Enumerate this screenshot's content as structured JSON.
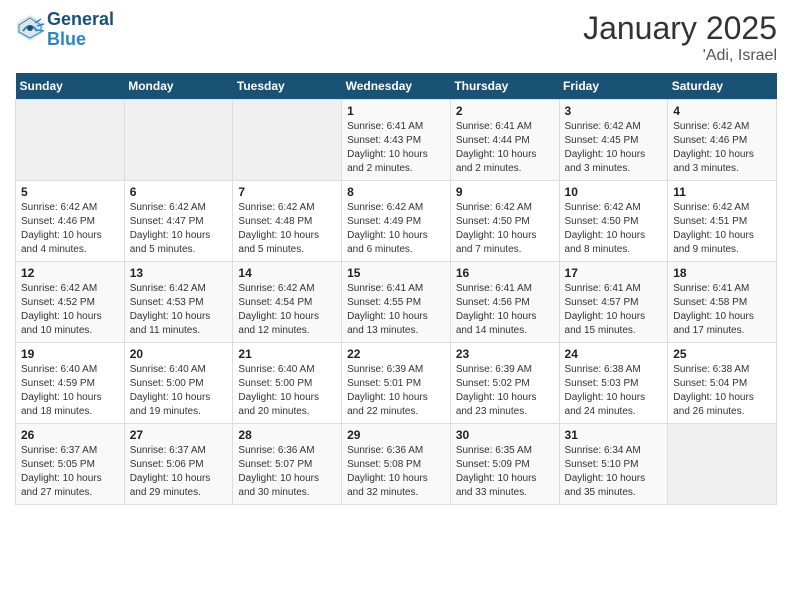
{
  "header": {
    "logo_line1": "General",
    "logo_line2": "Blue",
    "month": "January 2025",
    "location": "'Adi, Israel"
  },
  "weekdays": [
    "Sunday",
    "Monday",
    "Tuesday",
    "Wednesday",
    "Thursday",
    "Friday",
    "Saturday"
  ],
  "weeks": [
    [
      {
        "day": "",
        "sunrise": "",
        "sunset": "",
        "daylight": "",
        "empty": true
      },
      {
        "day": "",
        "sunrise": "",
        "sunset": "",
        "daylight": "",
        "empty": true
      },
      {
        "day": "",
        "sunrise": "",
        "sunset": "",
        "daylight": "",
        "empty": true
      },
      {
        "day": "1",
        "sunrise": "Sunrise: 6:41 AM",
        "sunset": "Sunset: 4:43 PM",
        "daylight": "Daylight: 10 hours and 2 minutes.",
        "empty": false
      },
      {
        "day": "2",
        "sunrise": "Sunrise: 6:41 AM",
        "sunset": "Sunset: 4:44 PM",
        "daylight": "Daylight: 10 hours and 2 minutes.",
        "empty": false
      },
      {
        "day": "3",
        "sunrise": "Sunrise: 6:42 AM",
        "sunset": "Sunset: 4:45 PM",
        "daylight": "Daylight: 10 hours and 3 minutes.",
        "empty": false
      },
      {
        "day": "4",
        "sunrise": "Sunrise: 6:42 AM",
        "sunset": "Sunset: 4:46 PM",
        "daylight": "Daylight: 10 hours and 3 minutes.",
        "empty": false
      }
    ],
    [
      {
        "day": "5",
        "sunrise": "Sunrise: 6:42 AM",
        "sunset": "Sunset: 4:46 PM",
        "daylight": "Daylight: 10 hours and 4 minutes.",
        "empty": false
      },
      {
        "day": "6",
        "sunrise": "Sunrise: 6:42 AM",
        "sunset": "Sunset: 4:47 PM",
        "daylight": "Daylight: 10 hours and 5 minutes.",
        "empty": false
      },
      {
        "day": "7",
        "sunrise": "Sunrise: 6:42 AM",
        "sunset": "Sunset: 4:48 PM",
        "daylight": "Daylight: 10 hours and 5 minutes.",
        "empty": false
      },
      {
        "day": "8",
        "sunrise": "Sunrise: 6:42 AM",
        "sunset": "Sunset: 4:49 PM",
        "daylight": "Daylight: 10 hours and 6 minutes.",
        "empty": false
      },
      {
        "day": "9",
        "sunrise": "Sunrise: 6:42 AM",
        "sunset": "Sunset: 4:50 PM",
        "daylight": "Daylight: 10 hours and 7 minutes.",
        "empty": false
      },
      {
        "day": "10",
        "sunrise": "Sunrise: 6:42 AM",
        "sunset": "Sunset: 4:50 PM",
        "daylight": "Daylight: 10 hours and 8 minutes.",
        "empty": false
      },
      {
        "day": "11",
        "sunrise": "Sunrise: 6:42 AM",
        "sunset": "Sunset: 4:51 PM",
        "daylight": "Daylight: 10 hours and 9 minutes.",
        "empty": false
      }
    ],
    [
      {
        "day": "12",
        "sunrise": "Sunrise: 6:42 AM",
        "sunset": "Sunset: 4:52 PM",
        "daylight": "Daylight: 10 hours and 10 minutes.",
        "empty": false
      },
      {
        "day": "13",
        "sunrise": "Sunrise: 6:42 AM",
        "sunset": "Sunset: 4:53 PM",
        "daylight": "Daylight: 10 hours and 11 minutes.",
        "empty": false
      },
      {
        "day": "14",
        "sunrise": "Sunrise: 6:42 AM",
        "sunset": "Sunset: 4:54 PM",
        "daylight": "Daylight: 10 hours and 12 minutes.",
        "empty": false
      },
      {
        "day": "15",
        "sunrise": "Sunrise: 6:41 AM",
        "sunset": "Sunset: 4:55 PM",
        "daylight": "Daylight: 10 hours and 13 minutes.",
        "empty": false
      },
      {
        "day": "16",
        "sunrise": "Sunrise: 6:41 AM",
        "sunset": "Sunset: 4:56 PM",
        "daylight": "Daylight: 10 hours and 14 minutes.",
        "empty": false
      },
      {
        "day": "17",
        "sunrise": "Sunrise: 6:41 AM",
        "sunset": "Sunset: 4:57 PM",
        "daylight": "Daylight: 10 hours and 15 minutes.",
        "empty": false
      },
      {
        "day": "18",
        "sunrise": "Sunrise: 6:41 AM",
        "sunset": "Sunset: 4:58 PM",
        "daylight": "Daylight: 10 hours and 17 minutes.",
        "empty": false
      }
    ],
    [
      {
        "day": "19",
        "sunrise": "Sunrise: 6:40 AM",
        "sunset": "Sunset: 4:59 PM",
        "daylight": "Daylight: 10 hours and 18 minutes.",
        "empty": false
      },
      {
        "day": "20",
        "sunrise": "Sunrise: 6:40 AM",
        "sunset": "Sunset: 5:00 PM",
        "daylight": "Daylight: 10 hours and 19 minutes.",
        "empty": false
      },
      {
        "day": "21",
        "sunrise": "Sunrise: 6:40 AM",
        "sunset": "Sunset: 5:00 PM",
        "daylight": "Daylight: 10 hours and 20 minutes.",
        "empty": false
      },
      {
        "day": "22",
        "sunrise": "Sunrise: 6:39 AM",
        "sunset": "Sunset: 5:01 PM",
        "daylight": "Daylight: 10 hours and 22 minutes.",
        "empty": false
      },
      {
        "day": "23",
        "sunrise": "Sunrise: 6:39 AM",
        "sunset": "Sunset: 5:02 PM",
        "daylight": "Daylight: 10 hours and 23 minutes.",
        "empty": false
      },
      {
        "day": "24",
        "sunrise": "Sunrise: 6:38 AM",
        "sunset": "Sunset: 5:03 PM",
        "daylight": "Daylight: 10 hours and 24 minutes.",
        "empty": false
      },
      {
        "day": "25",
        "sunrise": "Sunrise: 6:38 AM",
        "sunset": "Sunset: 5:04 PM",
        "daylight": "Daylight: 10 hours and 26 minutes.",
        "empty": false
      }
    ],
    [
      {
        "day": "26",
        "sunrise": "Sunrise: 6:37 AM",
        "sunset": "Sunset: 5:05 PM",
        "daylight": "Daylight: 10 hours and 27 minutes.",
        "empty": false
      },
      {
        "day": "27",
        "sunrise": "Sunrise: 6:37 AM",
        "sunset": "Sunset: 5:06 PM",
        "daylight": "Daylight: 10 hours and 29 minutes.",
        "empty": false
      },
      {
        "day": "28",
        "sunrise": "Sunrise: 6:36 AM",
        "sunset": "Sunset: 5:07 PM",
        "daylight": "Daylight: 10 hours and 30 minutes.",
        "empty": false
      },
      {
        "day": "29",
        "sunrise": "Sunrise: 6:36 AM",
        "sunset": "Sunset: 5:08 PM",
        "daylight": "Daylight: 10 hours and 32 minutes.",
        "empty": false
      },
      {
        "day": "30",
        "sunrise": "Sunrise: 6:35 AM",
        "sunset": "Sunset: 5:09 PM",
        "daylight": "Daylight: 10 hours and 33 minutes.",
        "empty": false
      },
      {
        "day": "31",
        "sunrise": "Sunrise: 6:34 AM",
        "sunset": "Sunset: 5:10 PM",
        "daylight": "Daylight: 10 hours and 35 minutes.",
        "empty": false
      },
      {
        "day": "",
        "sunrise": "",
        "sunset": "",
        "daylight": "",
        "empty": true
      }
    ]
  ]
}
